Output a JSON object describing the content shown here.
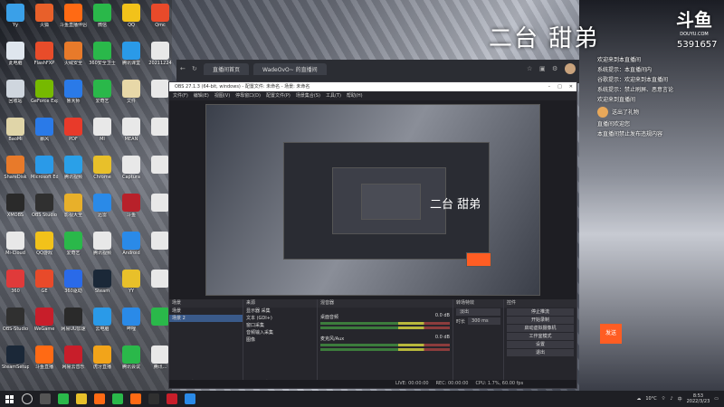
{
  "stream": {
    "title": "二台 甜弟",
    "brand_logo": "斗鱼",
    "brand_domain": "DOUYU.COM",
    "room_number": "5391657"
  },
  "desktop": {
    "icons_col1": [
      {
        "label": "Yy",
        "color": "#3aa0e8"
      },
      {
        "label": "此电脑",
        "color": "#dfe6ee"
      },
      {
        "label": "回收站",
        "color": "#cfd6de"
      },
      {
        "label": "BaoMi",
        "color": "#e0d5a8"
      },
      {
        "label": "ShareDisk",
        "color": "#e87a2a"
      },
      {
        "label": "XMOBS",
        "color": "#2a2a2a"
      },
      {
        "label": "Mi-Cloud",
        "color": "#e8e8e8"
      },
      {
        "label": "360",
        "color": "#e03a3a"
      },
      {
        "label": "OBS-Studio",
        "color": "#303030"
      },
      {
        "label": "SteamSetup",
        "color": "#1b2838"
      }
    ],
    "icons_col2": [
      {
        "label": "火狐",
        "color": "#e8602a"
      },
      {
        "label": "FlashFXP",
        "color": "#e84c2a"
      },
      {
        "label": "GeForce Experience",
        "color": "#76b900"
      },
      {
        "label": "暴风",
        "color": "#2a7ae8"
      },
      {
        "label": "Microsoft Edge",
        "color": "#2a9ae8"
      },
      {
        "label": "OBS Studio",
        "color": "#303030"
      },
      {
        "label": "QQ游戏",
        "color": "#f2c21a"
      },
      {
        "label": "GE",
        "color": "#e84a2a"
      },
      {
        "label": "WeGame",
        "color": "#c81e2a"
      },
      {
        "label": "斗鱼直播",
        "color": "#ff6a14"
      }
    ],
    "icons_col3": [
      {
        "label": "斗鱼直播伴侣",
        "color": "#ff6a14"
      },
      {
        "label": "火绒安全",
        "color": "#e87a2a"
      },
      {
        "label": "鲁大师",
        "color": "#2a7ae8"
      },
      {
        "label": "PDF",
        "color": "#e83a2a"
      },
      {
        "label": "腾讯视频",
        "color": "#2aa0e8"
      },
      {
        "label": "影视大全",
        "color": "#e8b02a"
      },
      {
        "label": "爱奇艺",
        "color": "#2ab84a"
      },
      {
        "label": "360驱动",
        "color": "#2a6ae8"
      },
      {
        "label": "网易UU加速",
        "color": "#2a2a2a"
      },
      {
        "label": "网易云音乐",
        "color": "#c81e2a"
      }
    ],
    "icons_col4": [
      {
        "label": "微信",
        "color": "#2ab84a"
      },
      {
        "label": "360安全卫士",
        "color": "#2ab84a"
      },
      {
        "label": "爱奇艺",
        "color": "#2ab84a"
      },
      {
        "label": "MI",
        "color": "#e8e8e8"
      },
      {
        "label": "Chrome",
        "color": "#e8c02a"
      },
      {
        "label": "迅雷",
        "color": "#2a8ae8"
      },
      {
        "label": "腾讯视频",
        "color": "#e8e8e8"
      },
      {
        "label": "Steam",
        "color": "#1b2838"
      },
      {
        "label": "云电脑",
        "color": "#2a9ae8"
      },
      {
        "label": "虎牙直播",
        "color": "#f2a41a"
      }
    ],
    "icons_col5": [
      {
        "label": "QQ",
        "color": "#f2c21a"
      },
      {
        "label": "腾讯课堂",
        "color": "#2a9ae8"
      },
      {
        "label": "文件",
        "color": "#e8d8a8"
      },
      {
        "label": "MEAN",
        "color": "#e8e8e8"
      },
      {
        "label": "Captura",
        "color": "#e8e8e8"
      },
      {
        "label": "斗鱼",
        "color": "#b8212a"
      },
      {
        "label": "Android",
        "color": "#2a8ae8"
      },
      {
        "label": "YY",
        "color": "#e8c02a"
      },
      {
        "label": "哔哩",
        "color": "#2a8ae8"
      },
      {
        "label": "腾讯会议",
        "color": "#2ab84a"
      }
    ],
    "icons_col6": [
      {
        "label": "Qmc",
        "color": "#e84a2a"
      },
      {
        "label": "20211224",
        "color": "#e8e8e8"
      },
      {
        "label": "",
        "color": "#e8e8e8"
      },
      {
        "label": "",
        "color": "#e8e8e8"
      },
      {
        "label": "",
        "color": "#e8e8e8"
      },
      {
        "label": "",
        "color": "#e8e8e8"
      },
      {
        "label": "",
        "color": "#e8e8e8"
      },
      {
        "label": "",
        "color": "#e8e8e8"
      },
      {
        "label": "",
        "color": "#2ab84a"
      },
      {
        "label": "腾讯...",
        "color": "#e8e8e8"
      }
    ]
  },
  "browser": {
    "tab_label": "WadeOvO~ 的直播间",
    "url_label": "直播间首页"
  },
  "obs": {
    "title": "OBS 27.1.3 (64-bit, windows) - 配置文件: 未命名 - 场景: 未命名",
    "menu": [
      "文件(F)",
      "编辑(E)",
      "视图(V)",
      "停靠窗口(D)",
      "配置文件(P)",
      "场景集合(S)",
      "工具(T)",
      "帮助(H)"
    ],
    "nested_title": "二台 甜弟",
    "docks": {
      "scenes_label": "场景",
      "scenes": [
        "场景",
        "场景 2"
      ],
      "sources_label": "来源",
      "sources": [
        "显示器 采集",
        "文本 (GDI+)",
        "窗口采集",
        "音频输入采集",
        "图像"
      ],
      "mixer_label": "混音器",
      "mixer": [
        {
          "name": "桌面音频",
          "db": "0.0 dB"
        },
        {
          "name": "麦克风/Aux",
          "db": "0.0 dB"
        }
      ],
      "transitions_label": "转场特效",
      "transition_value": "淡出",
      "duration_label": "时长",
      "duration_value": "300 ms",
      "controls_label": "控件",
      "controls": [
        "停止推流",
        "开始录制",
        "启动虚拟摄像机",
        "工作室模式",
        "设置",
        "退出"
      ]
    },
    "status": [
      "LIVE: 00:00:00",
      "REC: 00:00:00",
      "CPU: 1.7%, 60.00 fps"
    ]
  },
  "chat": {
    "lines": [
      {
        "user": "",
        "text": "欢迎来到本直播间"
      },
      {
        "user": "",
        "text": "系统提示：本直播间内"
      },
      {
        "user": "",
        "text": "谷歌提示：欢迎来到本直播间"
      },
      {
        "user": "",
        "text": "系统提示：禁止刷屏、恶意言论"
      },
      {
        "user": "",
        "text": "欢迎来到直播间"
      }
    ],
    "gift_text": "送出了礼物",
    "lines2": [
      {
        "user": "",
        "text": "直播间欢迎您"
      },
      {
        "user": "",
        "text": "本直播间禁止发布违规内容"
      }
    ],
    "send_label": "发送"
  },
  "taskbar": {
    "weather": "10°C",
    "ime": "中",
    "time": "8:53",
    "date": "2022/3/23"
  }
}
